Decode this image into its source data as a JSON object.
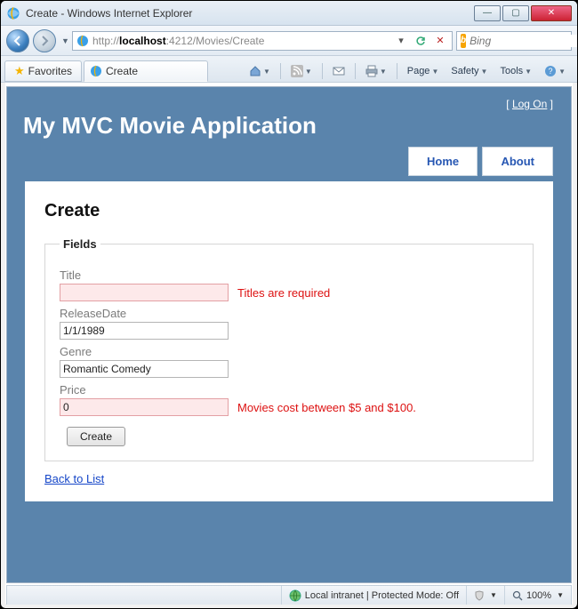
{
  "window": {
    "title": "Create - Windows Internet Explorer"
  },
  "address": {
    "prefix": "http://",
    "host": "localhost",
    "port_path": ":4212/Movies/Create"
  },
  "search": {
    "placeholder": "Bing"
  },
  "favorites_label": "Favorites",
  "tab": {
    "label": "Create"
  },
  "cmdbar": {
    "page": "Page",
    "safety": "Safety",
    "tools": "Tools"
  },
  "app": {
    "logon_prefix": "[ ",
    "logon_link": "Log On",
    "logon_suffix": " ]",
    "title": "My MVC Movie Application",
    "nav": {
      "home": "Home",
      "about": "About"
    }
  },
  "content": {
    "heading": "Create",
    "legend": "Fields",
    "title_label": "Title",
    "title_value": "",
    "title_error": "Titles are required",
    "releasedate_label": "ReleaseDate",
    "releasedate_value": "1/1/1989",
    "genre_label": "Genre",
    "genre_value": "Romantic Comedy",
    "price_label": "Price",
    "price_value": "0",
    "price_error": "Movies cost between $5 and $100.",
    "submit": "Create",
    "back": "Back to List"
  },
  "status": {
    "zone": "Local intranet | Protected Mode: Off",
    "zoom": "100%"
  }
}
